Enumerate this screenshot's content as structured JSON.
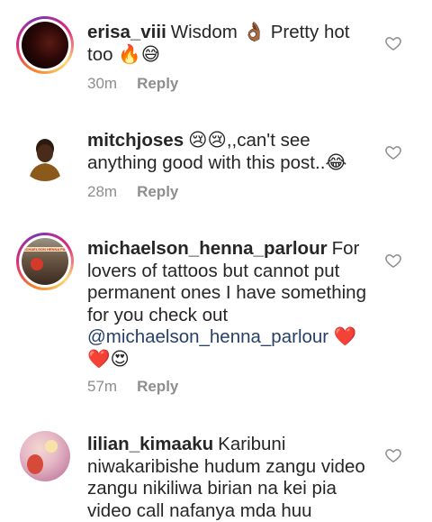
{
  "comments": [
    {
      "username": "erisa_viii",
      "text": "Wisdom 👌🏾 Pretty hot too 🔥😅",
      "time": "30m",
      "reply": "Reply"
    },
    {
      "username": "mitchjoses",
      "text": "😢😢,,can't see anything good with this post..😂",
      "time": "28m",
      "reply": "Reply"
    },
    {
      "username": "michaelson_henna_parlour",
      "text_before": "For lovers of tattoos but cannot put permanent ones I have something for you check out",
      "mention": "@michaelson_henna_parlour",
      "text_after": "❤️❤️😍",
      "time": "57m",
      "reply": "Reply"
    },
    {
      "username": "lilian_kimaaku",
      "text": "Karibuni niwakaribishe hudum zangu video zangu nikiliwa birian na kei pia video call nafanya mda huu"
    }
  ],
  "avatar_banner_text": "MICHAELSON HENNA PARLOUR",
  "icons": {
    "like": "heart-outline-icon"
  }
}
